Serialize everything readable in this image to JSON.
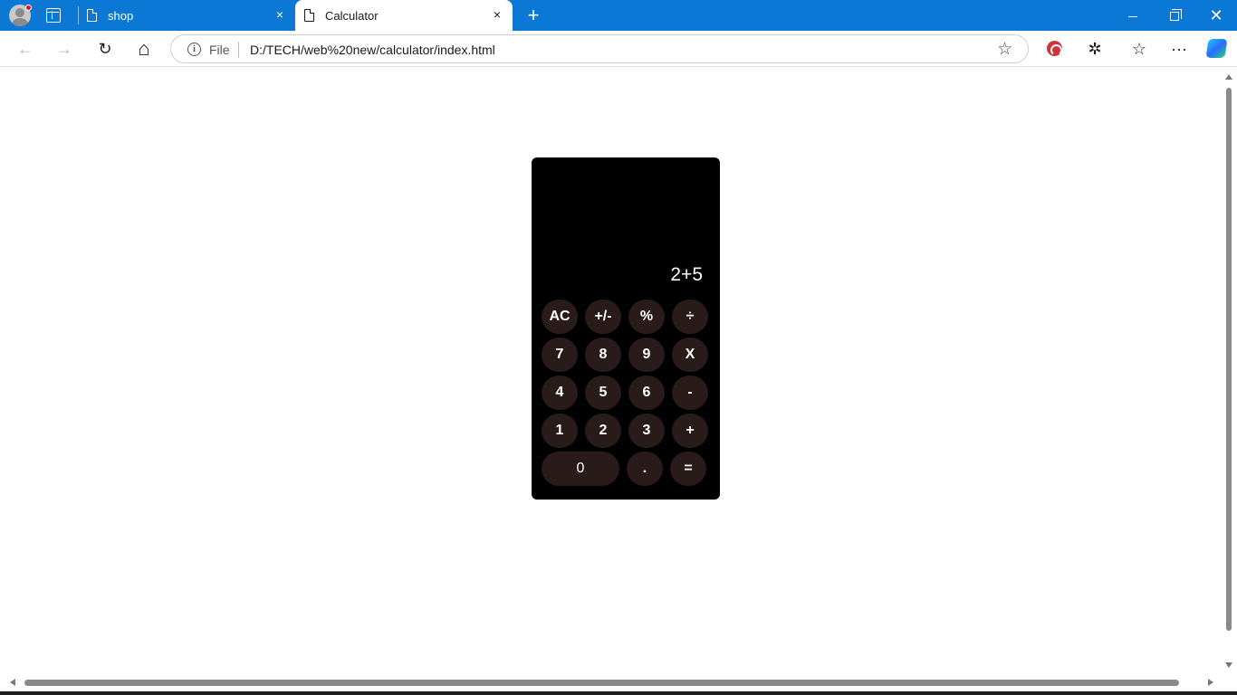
{
  "browser": {
    "tabs": [
      {
        "title": "shop",
        "active": false
      },
      {
        "title": "Calculator",
        "active": true
      }
    ],
    "address": {
      "scheme_label": "File",
      "url": "D:/TECH/web%20new/calculator/index.html"
    },
    "icons": {
      "profile": "profile-icon",
      "tab_actions": "tab-actions-icon",
      "close_tab": "×",
      "new_tab": "+",
      "back": "←",
      "forward": "→",
      "refresh": "↻",
      "home": "⌂",
      "favorite": "☆",
      "extensions": "✲",
      "favorites": "☆",
      "more": "···",
      "info": "i",
      "window_close": "✕"
    },
    "colors": {
      "titlebar": "#0a78d4",
      "calc_body": "#000000",
      "calc_key": "#2a1b1b"
    }
  },
  "calculator": {
    "display": "2+5",
    "keys": [
      [
        "AC",
        "+/-",
        "%",
        "÷"
      ],
      [
        "7",
        "8",
        "9",
        "X"
      ],
      [
        "4",
        "5",
        "6",
        "-"
      ],
      [
        "1",
        "2",
        "3",
        "+"
      ],
      [
        "0",
        ".",
        "="
      ]
    ]
  }
}
